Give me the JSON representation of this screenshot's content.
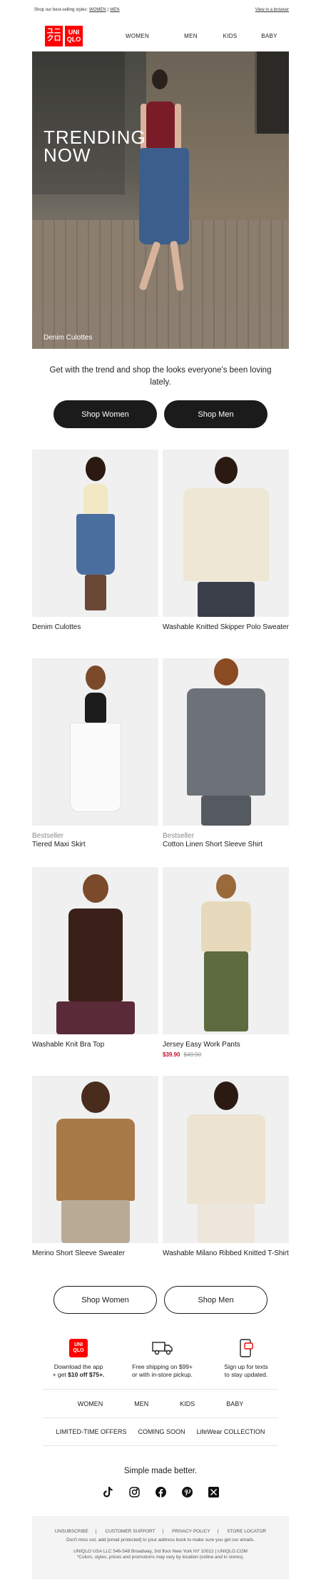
{
  "preheader": {
    "text": "Shop our best-selling styles:",
    "link_women": "WOMEN",
    "separator": "|",
    "link_men": "MEN",
    "browser_link": "View in a browser"
  },
  "logo": {
    "box1": "ユニ クロ",
    "box2": "UNI QLO"
  },
  "nav": [
    "WOMEN",
    "MEN",
    "KIDS",
    "BABY"
  ],
  "hero": {
    "title_line1": "TRENDING",
    "title_line2": "NOW",
    "caption": "Denim Culottes"
  },
  "intro": "Get with the trend and shop the looks everyone's been loving lately.",
  "buttons": {
    "women": "Shop Women",
    "men": "Shop Men"
  },
  "products": [
    {
      "tag": "",
      "name": "Denim Culottes"
    },
    {
      "tag": "",
      "name": "Washable Knitted Skipper Polo Sweater"
    },
    {
      "tag": "Bestseller",
      "name": "Tiered Maxi Skirt"
    },
    {
      "tag": "Bestseller",
      "name": "Cotton Linen Short Sleeve Shirt"
    },
    {
      "tag": "",
      "name": "Washable Knit Bra Top"
    },
    {
      "tag": "",
      "name": "Jersey Easy Work Pants",
      "sale_price": "$39.90",
      "original_price": "$49.90"
    },
    {
      "tag": "",
      "name": "Merino Short Sleeve Sweater"
    },
    {
      "tag": "",
      "name": "Washable Milano Ribbed Knitted T-Shirt"
    }
  ],
  "perks": [
    {
      "icon": "app-logo-icon",
      "line1": "Download the app",
      "line2_prefix": "+ get ",
      "line2_bold": "$10 off $75+."
    },
    {
      "icon": "truck-icon",
      "line1": "Free shipping on $99+",
      "line2": "or with in-store pickup."
    },
    {
      "icon": "phone-message-icon",
      "line1": "Sign up for texts",
      "line2": "to stay updated."
    }
  ],
  "footer_nav": [
    "WOMEN",
    "MEN",
    "KIDS",
    "BABY"
  ],
  "footer_nav2": [
    "LIMITED-TIME OFFERS",
    "COMING SOON",
    "LifeWear COLLECTION"
  ],
  "tagline": "Simple made better.",
  "social": [
    "tiktok-icon",
    "instagram-icon",
    "facebook-icon",
    "pinterest-icon",
    "x-icon"
  ],
  "footer": {
    "links": [
      "UNSUBSCRIBE",
      "CUSTOMER SUPPORT",
      "PRIVACY POLICY",
      "STORE LOCATOR"
    ],
    "separator": "|",
    "line1": "Don't miss out, add [email protected] to your address book to make sure you get our emails.",
    "line2": "UNIQLO USA LLC 546-548 Broadway, 3rd floor New York NY 10012 | UNIQLO.COM",
    "line3": "*Colors, styles, prices and promotions may vary by location (online and in stores)."
  },
  "colors": {
    "brand_red": "#ff0000",
    "button_dark": "#1b1b1b",
    "sale_red": "#c8102e"
  }
}
